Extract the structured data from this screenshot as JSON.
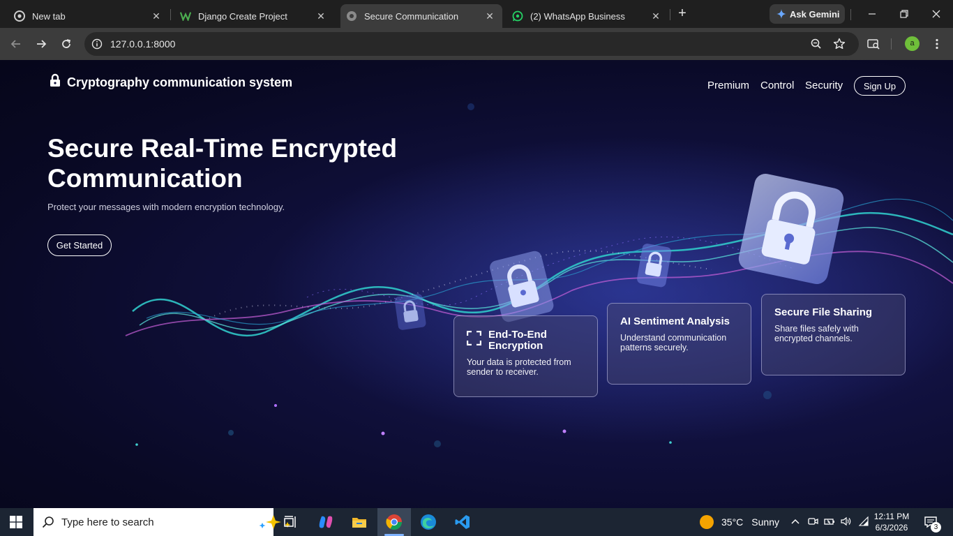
{
  "browser": {
    "tabs": [
      {
        "title": "New tab"
      },
      {
        "title": "Django Create Project"
      },
      {
        "title": "Secure Communication"
      },
      {
        "title": "(2) WhatsApp Business"
      }
    ],
    "gemini_label": "Ask Gemini",
    "url": "127.0.0.1:8000",
    "profile_initial": "a"
  },
  "site": {
    "brand": "Cryptography communication system",
    "nav": [
      "Premium",
      "Control",
      "Security"
    ],
    "signup": "Sign Up",
    "hero_title": "Secure Real-Time Encrypted Communication",
    "hero_subtitle": "Protect your messages with modern encryption technology.",
    "cta": "Get Started",
    "cards": [
      {
        "title": "End-To-End Encryption",
        "desc": "Your data is protected from sender to receiver."
      },
      {
        "title": "AI Sentiment Analysis",
        "desc": "Understand communication patterns securely."
      },
      {
        "title": "Secure File Sharing",
        "desc": "Share files safely with encrypted channels."
      }
    ]
  },
  "taskbar": {
    "search_placeholder": "Type here to search",
    "weather_temp": "35°C",
    "weather_cond": "Sunny",
    "time": "12:11 PM",
    "date": "6/3/2026",
    "notification_count": "3"
  }
}
